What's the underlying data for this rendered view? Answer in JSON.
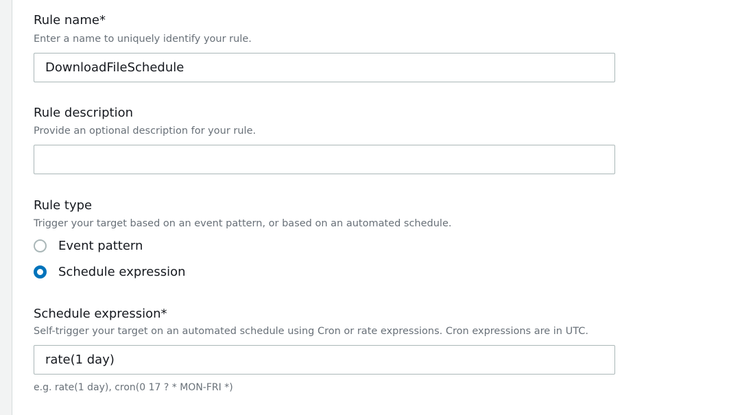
{
  "rule_name": {
    "label": "Rule name*",
    "description": "Enter a name to uniquely identify your rule.",
    "value": "DownloadFileSchedule"
  },
  "rule_description": {
    "label": "Rule description",
    "description": "Provide an optional description for your rule.",
    "value": ""
  },
  "rule_type": {
    "label": "Rule type",
    "description": "Trigger your target based on an event pattern, or based on an automated schedule.",
    "options": [
      {
        "label": "Event pattern",
        "selected": false
      },
      {
        "label": "Schedule expression",
        "selected": true
      }
    ]
  },
  "schedule_expression": {
    "label": "Schedule expression*",
    "description": "Self-trigger your target on an automated schedule using Cron or rate expressions. Cron expressions are in UTC.",
    "value": "rate(1 day)",
    "hint": "e.g. rate(1 day), cron(0 17 ? * MON-FRI *)"
  },
  "colors": {
    "accent": "#0073bb"
  }
}
